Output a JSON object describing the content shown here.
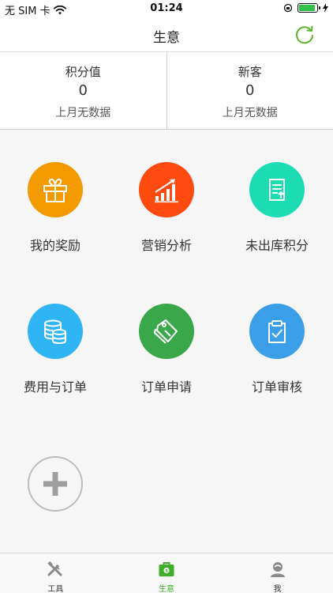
{
  "status_bar": {
    "carrier": "无 SIM 卡",
    "time": "01:24",
    "battery_level": 0.9
  },
  "header": {
    "title": "生意"
  },
  "stats": [
    {
      "label": "积分值",
      "value": "0",
      "sub": "上月无数据"
    },
    {
      "label": "新客",
      "value": "0",
      "sub": "上月无数据"
    }
  ],
  "tiles": [
    {
      "label": "我的奖励",
      "icon": "gift-icon",
      "color": "#f39a00"
    },
    {
      "label": "营销分析",
      "icon": "bar-chart-icon",
      "color": "#ff4a0f"
    },
    {
      "label": "未出库积分",
      "icon": "document-upload-icon",
      "color": "#1ddbb3"
    },
    {
      "label": "费用与订单",
      "icon": "database-icon",
      "color": "#2fb4f4"
    },
    {
      "label": "订单申请",
      "icon": "tag-icon",
      "color": "#3aa84a"
    },
    {
      "label": "订单审核",
      "icon": "clipboard-check-icon",
      "color": "#3a9ee8"
    }
  ],
  "tabs": [
    {
      "label": "工具",
      "icon": "tools-icon",
      "active": false
    },
    {
      "label": "生意",
      "icon": "briefcase-icon",
      "active": true
    },
    {
      "label": "我",
      "icon": "user-icon",
      "active": false
    }
  ],
  "colors": {
    "accent": "#3fae2a",
    "background": "#f7f6f7"
  }
}
